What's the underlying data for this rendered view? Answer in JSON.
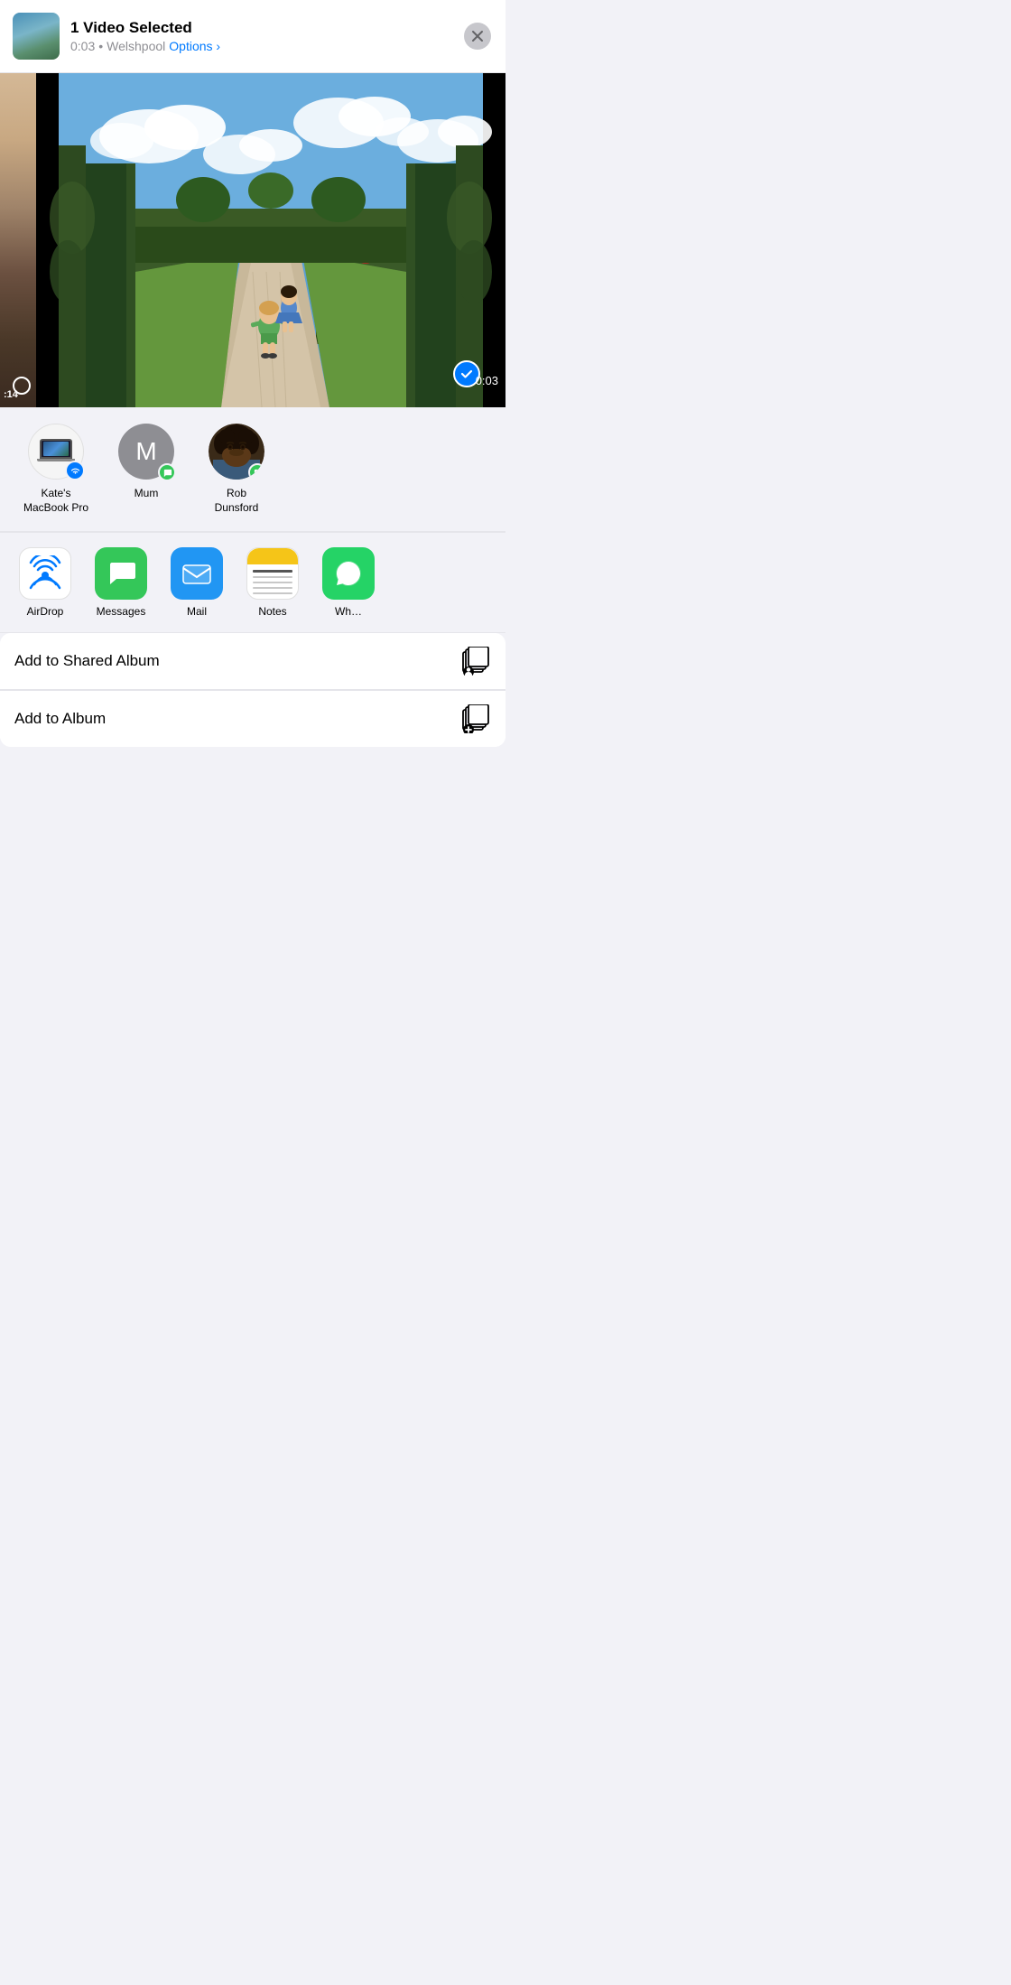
{
  "header": {
    "title": "1 Video Selected",
    "subtitle_time": "0:03",
    "subtitle_dot": "•",
    "subtitle_location": "Welshpool",
    "options_label": "Options",
    "options_chevron": "›",
    "close_icon": "close-icon"
  },
  "media": {
    "check_timestamp": "0:03",
    "prev_timestamp": ":14"
  },
  "contacts": {
    "items": [
      {
        "id": "kates-macbook",
        "name": "Kate's MacBook Pro",
        "type": "macbook",
        "badge": "airdrop"
      },
      {
        "id": "mum",
        "name": "Mum",
        "type": "letter",
        "letter": "M",
        "badge": "message"
      },
      {
        "id": "rob-dunsford",
        "name": "Rob Dunsford",
        "type": "photo",
        "badge": "message"
      }
    ]
  },
  "apps": {
    "items": [
      {
        "id": "airdrop",
        "label": "AirDrop",
        "type": "airdrop"
      },
      {
        "id": "messages",
        "label": "Messages",
        "type": "messages"
      },
      {
        "id": "mail",
        "label": "Mail",
        "type": "mail"
      },
      {
        "id": "notes",
        "label": "Notes",
        "type": "notes"
      },
      {
        "id": "whatsapp",
        "label": "Wh…",
        "type": "whatsapp"
      }
    ]
  },
  "actions": {
    "items": [
      {
        "id": "add-shared-album",
        "label": "Add to Shared Album",
        "icon": "shared-album-icon"
      },
      {
        "id": "add-album",
        "label": "Add to Album",
        "icon": "add-album-icon"
      }
    ]
  },
  "colors": {
    "accent_blue": "#007aff",
    "green": "#34c759",
    "background": "#f2f2f7",
    "separator": "#e5e5ea"
  }
}
